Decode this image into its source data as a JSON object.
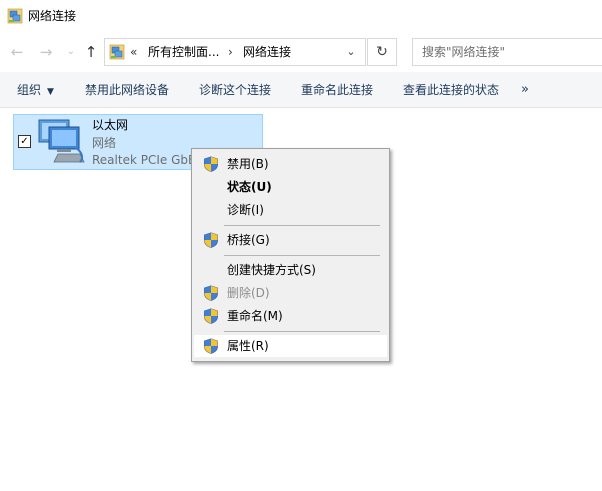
{
  "window": {
    "title": "网络连接"
  },
  "nav": {
    "back_icon": "←",
    "forward_icon": "→",
    "recent_icon": "⌄",
    "up_icon": "↑"
  },
  "address": {
    "overflow": "«",
    "crumbs": [
      "所有控制面...",
      "网络连接"
    ],
    "separator": "›",
    "dropdown_icon": "⌄",
    "refresh_icon": "↻"
  },
  "search": {
    "placeholder": "搜索\"网络连接\""
  },
  "toolbar": {
    "organize": "组织",
    "organize_caret": "▼",
    "items": [
      "禁用此网络设备",
      "诊断这个连接",
      "重命名此连接",
      "查看此连接的状态"
    ],
    "more": "»"
  },
  "connection": {
    "name": "以太网",
    "type": "网络",
    "device": "Realtek PCIe GbE Family Controller",
    "checked_mark": "✓"
  },
  "context_menu": {
    "items": [
      {
        "label": "禁用(B)",
        "icon": "uac-shield-icon"
      },
      {
        "label": "状态(U)",
        "bold": true
      },
      {
        "label": "诊断(I)"
      },
      {
        "label": "桥接(G)",
        "icon": "uac-shield-icon"
      },
      {
        "label": "创建快捷方式(S)"
      },
      {
        "label": "删除(D)",
        "icon": "uac-shield-icon",
        "disabled": true
      },
      {
        "label": "重命名(M)",
        "icon": "uac-shield-icon"
      },
      {
        "label": "属性(R)",
        "icon": "uac-shield-icon",
        "highlighted": true
      }
    ]
  },
  "colors": {
    "selection_bg": "#cce8ff",
    "selection_border": "#99d1ff",
    "menu_bg": "#f0f0f0",
    "toolbar_text": "#1e395b"
  }
}
